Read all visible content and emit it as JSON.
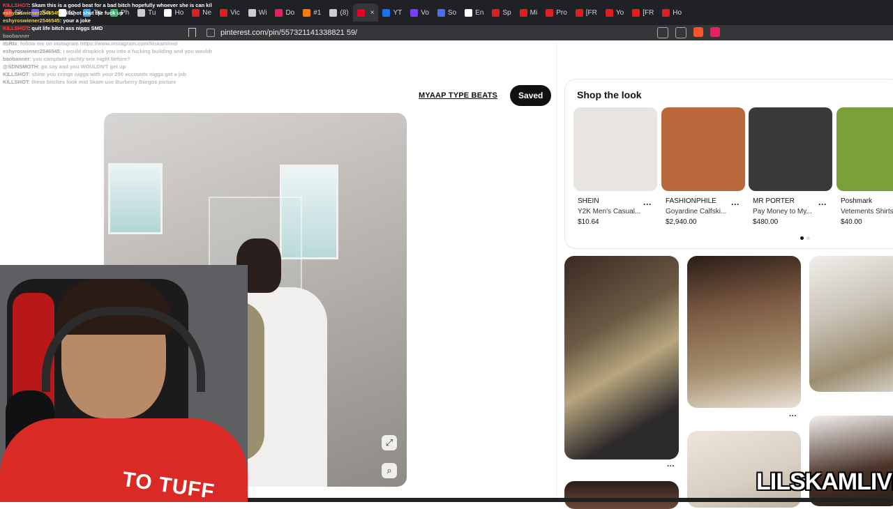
{
  "browser": {
    "tabs": [
      {
        "label": "Sk",
        "color": "#e04040"
      },
      {
        "label": "Sn",
        "color": "#7a5cff"
      },
      {
        "label": "tq",
        "color": "#ffffff"
      },
      {
        "label": "Tp",
        "color": "#2fa8ff"
      },
      {
        "label": "Ph",
        "color": "#2eb872"
      },
      {
        "label": "Tu",
        "color": "#cccccc"
      },
      {
        "label": "Ho",
        "color": "#ffffff"
      },
      {
        "label": "Ne",
        "color": "#e02020"
      },
      {
        "label": "Vic",
        "color": "#e02020"
      },
      {
        "label": "Wi",
        "color": "#cccccc"
      },
      {
        "label": "Do",
        "color": "#e0245e"
      },
      {
        "label": "#1",
        "color": "#ff7a00"
      },
      {
        "label": "(8)",
        "color": "#cccccc"
      },
      {
        "label": "",
        "color": "#e60023"
      },
      {
        "label": "YT",
        "color": "#1d72f2"
      },
      {
        "label": "Vo",
        "color": "#7a3cff"
      },
      {
        "label": "So",
        "color": "#4a6cff"
      },
      {
        "label": "En",
        "color": "#ffffff"
      },
      {
        "label": "Sp",
        "color": "#e02020"
      },
      {
        "label": "Mi",
        "color": "#e02020"
      },
      {
        "label": "Pro",
        "color": "#e02020"
      },
      {
        "label": "[FR",
        "color": "#e02020"
      },
      {
        "label": "Yo",
        "color": "#e02020"
      },
      {
        "label": "[FR",
        "color": "#e02020"
      },
      {
        "label": "Ho",
        "color": "#e02020"
      }
    ],
    "url": "pinterest.com/pin/557321141338821 59/"
  },
  "chat": [
    {
      "user": "KILLSHOT",
      "user_color": "#ff3b3b",
      "message": ": Skam this is a good beat for a bad bitch hopefully whoever she is can kill it",
      "faint": false
    },
    {
      "user": "eshyroswiener2546545",
      "user_color": "#e8d14a",
      "message": ": killshot shut the fuck up",
      "faint": false
    },
    {
      "user": "eshyroswiener2546545",
      "user_color": "#e8d14a",
      "message": ": your a joke",
      "faint": false
    },
    {
      "user": "KILLSHOT",
      "user_color": "#ff3b3b",
      "message": ": quit life bitch ass niggs SMD",
      "faint": false
    },
    {
      "user": "baobanner",
      "user_color": "#a0a0a0",
      "message": "",
      "faint": true
    },
    {
      "user": "itsRIs",
      "user_color": "#a0a0a0",
      "message": ": follow me on instagram https://www.instagram.com/lilskamlive/",
      "faint": true
    },
    {
      "user": "eshyroswiener2546545",
      "user_color": "#a0a0a0",
      "message": ": i would dropkick you into a fucking building and you wouldn't get up",
      "faint": true
    },
    {
      "user": "baobanner",
      "user_color": "#a0a0a0",
      "message": ": you camplant yachty one night before?",
      "faint": true
    },
    {
      "user": "@SDNSMOTH",
      "user_color": "#a0a0a0",
      "message": ": go say and you WOULDN'T get up",
      "faint": true
    },
    {
      "user": "KILLSHOT",
      "user_color": "#a0a0a0",
      "message": ": shine you cringe nigga with your 200 accounts nigga get a job",
      "faint": true
    },
    {
      "user": "KILLSHOT",
      "user_color": "#a0a0a0",
      "message": ": these bitches look mid Skam use Burberry Burgos picture",
      "faint": true
    }
  ],
  "pin": {
    "board_label": "MYAAP TYPE BEATS",
    "save_label": "Saved"
  },
  "shop_the_look": {
    "title": "Shop the look",
    "products": [
      {
        "brand": "SHEIN",
        "name": "Y2K Men's Casual...",
        "price": "$10.64",
        "color": "#e8e4e0"
      },
      {
        "brand": "FASHIONPHILE",
        "name": "Goyardine Calfski...",
        "price": "$2,940.00",
        "color": "#b8683a"
      },
      {
        "brand": "MR PORTER",
        "name": "Pay Money to My...",
        "price": "$480.00",
        "color": "#3a3a38"
      },
      {
        "brand": "Poshmark",
        "name": "Vetements Shirts",
        "price": "$40.00",
        "color": "#7aa03a"
      }
    ]
  },
  "watermark": "LILSKAMLIVE",
  "webcam": {
    "shirt_text": "TO TUFF"
  }
}
